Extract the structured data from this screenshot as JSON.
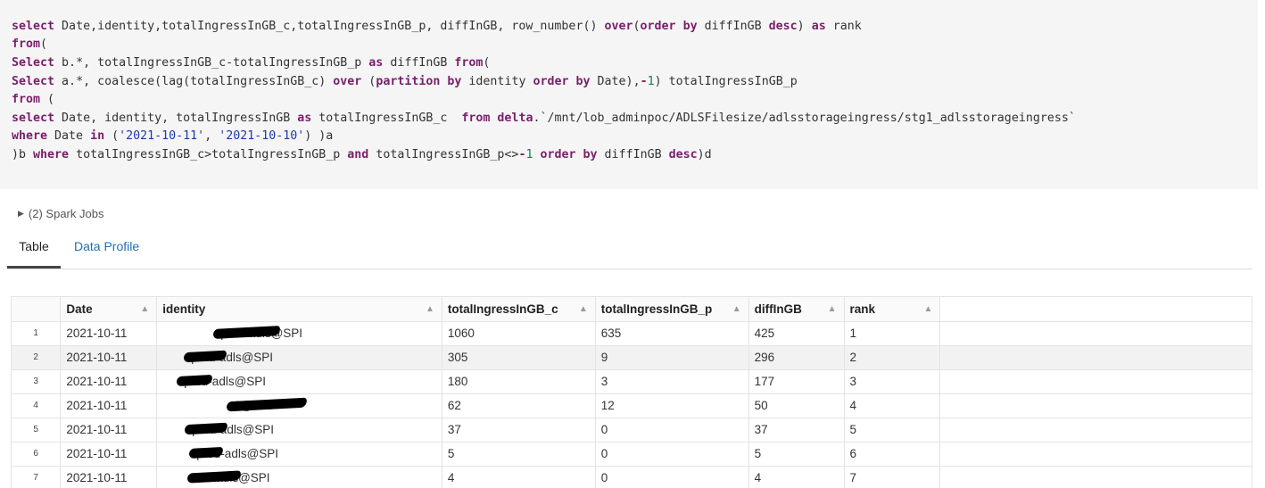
{
  "code": {
    "lines": [
      "select Date,identity,totalIngressInGB_c,totalIngressInGB_p, diffInGB, row_number() over(order by diffInGB desc) as rank",
      "from(",
      "Select b.*, totalIngressInGB_c-totalIngressInGB_p as diffInGB from(",
      "Select a.*, coalesce(lag(totalIngressInGB_c) over (partition by identity order by Date),-1) totalIngressInGB_p",
      "from (",
      "select Date, identity, totalIngressInGB as totalIngressInGB_c  from delta.`/mnt/lob_adminpoc/ADLSFilesize/adlsstorageingress/stg1_adlsstorageingress`",
      "where Date in ('2021-10-11', '2021-10-10') )a",
      ")b where totalIngressInGB_c>totalIngressInGB_p and totalIngressInGB_p<>-1 order by diffInGB desc)d"
    ]
  },
  "spark_jobs": {
    "label": "(2) Spark Jobs"
  },
  "tabs": [
    {
      "label": "Table",
      "active": true
    },
    {
      "label": "Data Profile",
      "active": false
    }
  ],
  "table": {
    "columns": [
      "Date",
      "identity",
      "totalIngressInGB_c",
      "totalIngressInGB_p",
      "diffInGB",
      "rank"
    ],
    "rows": [
      [
        "1",
        "2021-10-11",
        "prod-adls@SPI",
        "1060",
        "635",
        "425",
        "1"
      ],
      [
        "2",
        "2021-10-11",
        "prod-adls@SPI",
        "305",
        "9",
        "296",
        "2"
      ],
      [
        "3",
        "2021-10-11",
        "prod-adls@SPI",
        "180",
        "3",
        "177",
        "3"
      ],
      [
        "4",
        "2021-10-11",
        "1@SPI",
        "62",
        "12",
        "50",
        "4"
      ],
      [
        "5",
        "2021-10-11",
        "prod-adls@SPI",
        "37",
        "0",
        "37",
        "5"
      ],
      [
        "6",
        "2021-10-11",
        "prod-adls@SPI",
        "5",
        "0",
        "5",
        "6"
      ],
      [
        "7",
        "2021-10-11",
        "rod-adls@SPI",
        "4",
        "0",
        "4",
        "7"
      ]
    ]
  },
  "colors": {
    "keyword": "#7a1f6b",
    "string": "#1a3aa8",
    "link": "#1e6fb8",
    "code_bg": "#f5f5f5"
  }
}
